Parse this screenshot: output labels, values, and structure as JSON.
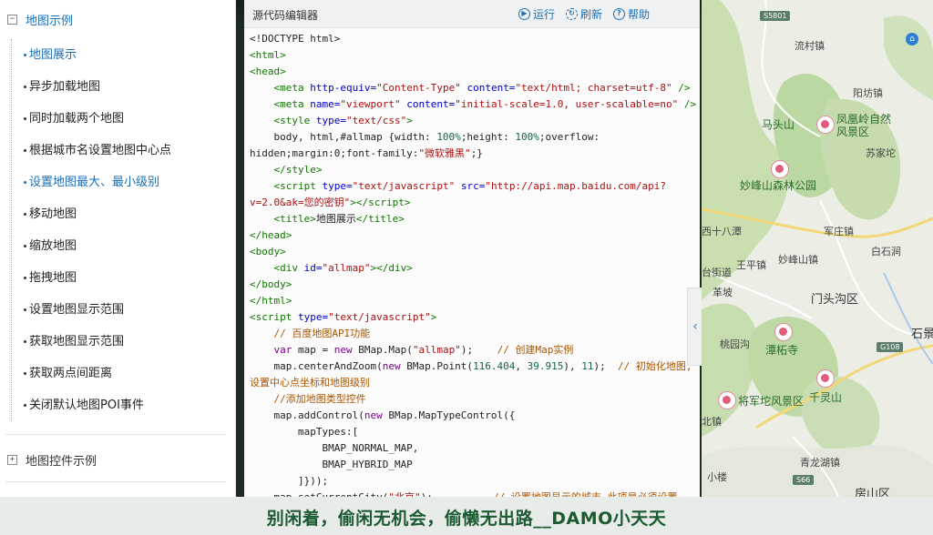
{
  "sidebar": {
    "group1": {
      "toggle": "−",
      "label": "地图示例"
    },
    "items": [
      {
        "label": "地图展示",
        "active": true
      },
      {
        "label": "异步加载地图"
      },
      {
        "label": "同时加载两个地图"
      },
      {
        "label": "根据城市名设置地图中心点"
      },
      {
        "label": "设置地图最大、最小级别",
        "active": true
      },
      {
        "label": "移动地图"
      },
      {
        "label": "缩放地图"
      },
      {
        "label": "拖拽地图"
      },
      {
        "label": "设置地图显示范围"
      },
      {
        "label": "获取地图显示范围"
      },
      {
        "label": "获取两点间距离"
      },
      {
        "label": "关闭默认地图POI事件"
      }
    ],
    "group2": {
      "toggle": "+",
      "label": "地图控件示例"
    }
  },
  "editor": {
    "title": "源代码编辑器",
    "run_label": "运行",
    "refresh_label": "刷新",
    "help_label": "帮助",
    "collapse_label": "‹"
  },
  "map": {
    "labels": {
      "s5801": "S5801",
      "liucun": "流村镇",
      "yangfang": "阳坊镇",
      "matoushan": "马头山",
      "fenghuangling1": "凤凰岭自然",
      "fenghuangling2": "风景区",
      "sujiatuo": "苏家坨",
      "miaofengshan": "妙峰山森林公园",
      "junzhuang": "军庄镇",
      "shibaxi": "西十八潭",
      "baishan": "白石涧",
      "wangping": "王平镇",
      "miaofengzhen": "妙峰山镇",
      "dajie": "台街道",
      "mentougou": "门头沟区",
      "yanchi": "革坡",
      "shijing": "石景",
      "taohegou": "桃园沟",
      "tanzhesi": "潭柘寺",
      "g108": "G108",
      "jiangjun": "将军坨风景区",
      "qianlingshan": "千灵山",
      "beizhen": "北镇",
      "qinglonghu": "青龙湖镇",
      "xiaolou": "小楼",
      "s66": "S66",
      "fangshan": "房山区"
    }
  },
  "banner": {
    "text": "别闲着，偷闲无机会，偷懒无出路__DAMO小天天"
  }
}
